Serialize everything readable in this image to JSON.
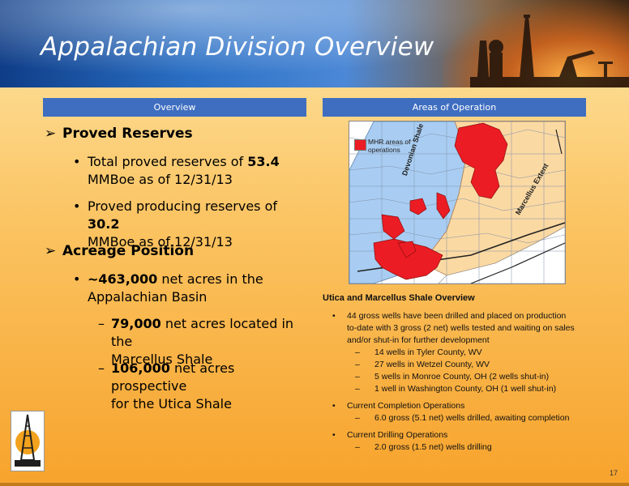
{
  "title": "Appalachian Division Overview",
  "tabs": {
    "overview": "Overview",
    "areas": "Areas of Operation"
  },
  "left": {
    "proved_reserves": {
      "heading": "Proved Reserves",
      "b1": {
        "pre": "Total proved reserves of ",
        "bold": "53.4",
        "line2": "MMBoe as of 12/31/13"
      },
      "b2": {
        "pre": "Proved producing reserves of ",
        "bold": "30.2",
        "line2": "MMBoe as of 12/31/13"
      }
    },
    "acreage": {
      "heading": "Acreage Position",
      "b1": {
        "bold": "~463,000",
        "post": " net acres in the",
        "line2": "Appalachian Basin"
      },
      "s1": {
        "bold": "79,000",
        "post": " net acres located in the",
        "line2": "Marcellus Shale"
      },
      "s2": {
        "bold": "106,000",
        "post": " net acres prospective",
        "line2": "for the Utica Shale"
      }
    }
  },
  "map": {
    "legend": "MHR areas of operations",
    "labels": {
      "devonian": "Devonian Shale",
      "marcellus": "Marcellus Extent"
    },
    "colors": {
      "operations": "#ec1c24",
      "devonian": "#a9cdf2",
      "marcellus": "#fbd9a3",
      "outside": "#ffffff"
    }
  },
  "right": {
    "heading": "Utica and Marcellus Shale Overview",
    "b1": {
      "lines": [
        "44 gross wells have been drilled and placed on production",
        "to-date with 3 gross (2 net) wells tested and waiting on sales",
        "and/or shut-in for further development"
      ],
      "subs": [
        "14 wells in Tyler County, WV",
        "27 wells in Wetzel County, WV",
        "5 wells in Monroe County, OH (2 wells shut-in)",
        "1 well in Washington County, OH (1 well shut-in)"
      ]
    },
    "b2": {
      "text": "Current Completion Operations",
      "subs": [
        "6.0 gross (5.1 net) wells drilled, awaiting completion"
      ]
    },
    "b3": {
      "text": "Current Drilling Operations",
      "subs": [
        "2.0 gross (1.5 net) wells drilling"
      ]
    }
  },
  "page_number": "17",
  "icons": {
    "arrow": "arrow-bullet-icon",
    "logo": "derrick-logo"
  }
}
